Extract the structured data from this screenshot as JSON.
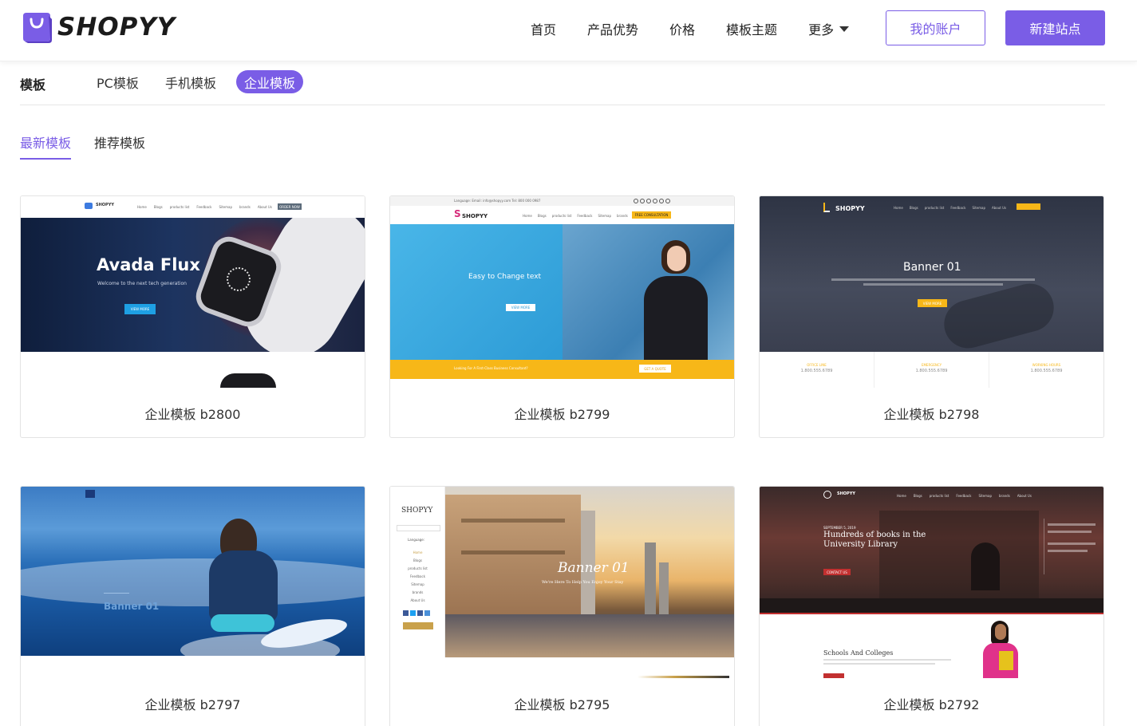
{
  "header": {
    "logo_text": "SHOPYY",
    "nav": [
      "首页",
      "产品优势",
      "价格",
      "模板主题",
      "更多"
    ],
    "account_button": "我的账户",
    "new_site_button": "新建站点"
  },
  "categories": {
    "label": "模板",
    "tabs": [
      "PC模板",
      "手机模板",
      "企业模板"
    ],
    "active": "企业模板"
  },
  "sub_tabs": {
    "items": [
      "最新模板",
      "推荐模板"
    ],
    "active": "最新模板"
  },
  "templates": [
    {
      "name": "企业模板 b2800",
      "preview": {
        "brand": "SHOPYY",
        "nav": [
          "Home",
          "Blogs",
          "products list",
          "Feedback",
          "Sitemap",
          "brands",
          "About Us"
        ],
        "cta": "ORDER NOW",
        "headline": "Avada Flux",
        "subline": "Welcome to the next tech generation",
        "button": "VIEW MORE"
      }
    },
    {
      "name": "企业模板 b2799",
      "preview": {
        "brand": "SHOPYY",
        "topbar": "Language:    Email: info@shopyy.com    Tel: 800 000 0987",
        "nav": [
          "Home",
          "Blogs",
          "products list",
          "Feedback",
          "Sitemap",
          "brands",
          "About Us"
        ],
        "cta": "FREE CONSULTATION",
        "headline": "Easy to Change text",
        "button": "VIEW MORE",
        "strip": "Looking For A First-Class Business Consultant?",
        "strip_button": "GET A QUOTE"
      }
    },
    {
      "name": "企业模板 b2798",
      "preview": {
        "brand": "SHOPYY",
        "nav": [
          "Home",
          "Blogs",
          "products list",
          "Feedback",
          "Sitemap",
          "About Us"
        ],
        "headline": "Banner 01",
        "button": "VIEW MORE",
        "contacts": [
          {
            "label": "OFFICE LINE",
            "value": "1.800.555.6789"
          },
          {
            "label": "EMERGENCY",
            "value": "1.800.555.6789"
          },
          {
            "label": "WORKING HOURS",
            "value": "1.800.555.6789"
          }
        ]
      }
    },
    {
      "name": "企业模板 b2797",
      "preview": {
        "headline": "Banner 01"
      }
    },
    {
      "name": "企业模板 b2795",
      "preview": {
        "brand": "SHOPYY",
        "language": "Language:",
        "menu": [
          "Home",
          "Blogs",
          "products list",
          "Feedback",
          "Sitemap",
          "brands",
          "About Us"
        ],
        "headline": "Banner 01",
        "subline": "We're Here To Help You Enjoy Your Stay"
      }
    },
    {
      "name": "企业模板 b2792",
      "preview": {
        "brand": "SHOPYY",
        "nav": [
          "Home",
          "Blogs",
          "products list",
          "Feedback",
          "Sitemap",
          "brands",
          "About Us"
        ],
        "date": "SEPTEMBER 5, 2019",
        "headline": "Hundreds of books in the University Library",
        "button": "CONTACT US",
        "section": "Schools And Colleges"
      }
    }
  ],
  "colors": {
    "accent": "#7a5de6",
    "text": "#333333"
  }
}
